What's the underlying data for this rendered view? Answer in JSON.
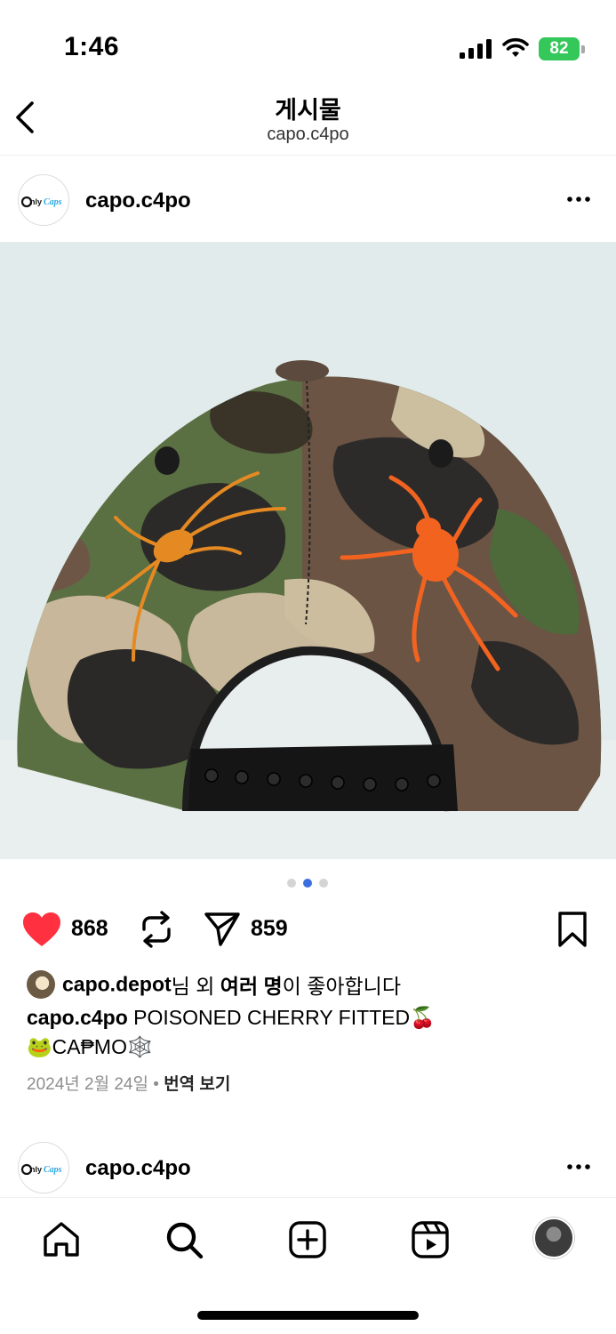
{
  "status_bar": {
    "time": "1:46",
    "battery": "82",
    "icons": [
      "cellular-signal-icon",
      "wifi-icon",
      "battery-icon"
    ]
  },
  "nav": {
    "title": "게시물",
    "subtitle": "capo.c4po",
    "back_icon": "chevron-left-icon"
  },
  "post": {
    "username": "capo.c4po",
    "avatar_logo_text": "OnlyCaps",
    "carousel": {
      "count": 3,
      "active_index": 1
    },
    "actions": {
      "like_count": "868",
      "repost_count": "",
      "share_count": "859",
      "liked": true
    },
    "liked_by": {
      "user": "capo.depot",
      "text_1": "님 외 ",
      "others": "여러 명",
      "text_2": "이 좋아합니다"
    },
    "caption": {
      "username": "capo.c4po",
      "line1": " POISONED CHERRY FITTED🍒",
      "line2": "🐸CA₱MO🕸️"
    },
    "date": "2024년 2월 24일",
    "separator": " • ",
    "translate_label": "번역 보기"
  },
  "next_post": {
    "username": "capo.c4po"
  },
  "tab_bar": {
    "items": [
      "home-icon",
      "search-icon",
      "create-icon",
      "reels-icon",
      "profile-avatar"
    ]
  },
  "colors": {
    "like_red": "#ff3040",
    "text": "#000000",
    "muted": "#8e8e8e",
    "battery_green": "#34c759",
    "active_dot": "#3b6fe0"
  }
}
